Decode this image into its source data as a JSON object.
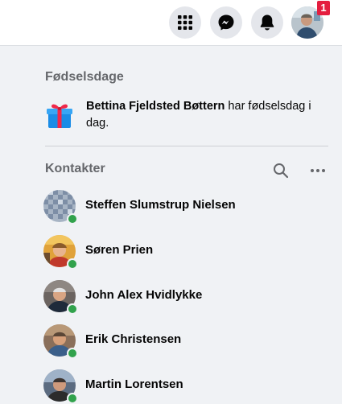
{
  "topbar": {
    "menu_icon": "grid-menu-icon",
    "messenger_icon": "messenger-icon",
    "notifications_icon": "bell-icon",
    "account_avatar": "account-avatar",
    "notification_count": "1"
  },
  "birthdays": {
    "title": "Fødselsdage",
    "icon": "gift-icon",
    "person": "Bettina Fjeldsted Bøttern",
    "text": " har fødselsdag i dag."
  },
  "contacts": {
    "title": "Kontakter",
    "search_icon": "search-icon",
    "more_icon": "more-options-icon",
    "items": [
      {
        "name": "Steffen Slumstrup Nielsen",
        "online": true
      },
      {
        "name": "Søren Prien",
        "online": true
      },
      {
        "name": "John Alex Hvidlykke",
        "online": true
      },
      {
        "name": "Erik Christensen",
        "online": true
      },
      {
        "name": "Martin Lorentsen",
        "online": true
      }
    ]
  },
  "colors": {
    "online": "#31a24c",
    "badge": "#e41e3f",
    "background": "#f0f2f5",
    "secondary_text": "#65676b"
  }
}
